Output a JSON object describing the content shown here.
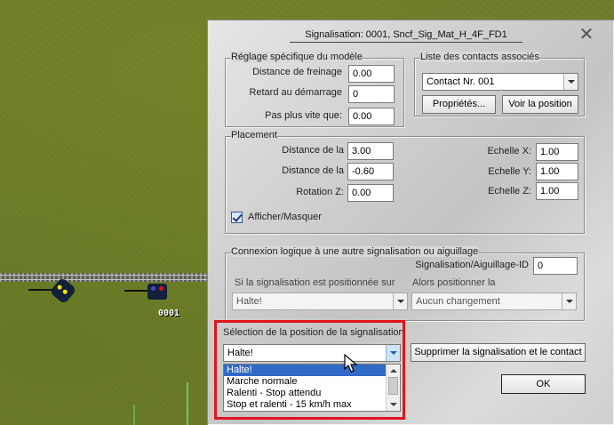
{
  "scene": {
    "signal_id_label": "0001"
  },
  "dialog": {
    "title": "Signalisation: 0001, Sncf_Sig_Mat_H_4F_FD1",
    "close_icon": "close-icon",
    "model_group": {
      "legend": "Réglage spécifique du modèle",
      "fields": [
        {
          "label": "Distance de freinage",
          "value": "0.00"
        },
        {
          "label": "Retard au démarrage",
          "value": "0"
        },
        {
          "label": "Pas plus vite que:",
          "value": "0.00"
        }
      ]
    },
    "contacts_group": {
      "legend": "Liste des contacts associés",
      "selected": "Contact Nr. 001",
      "properties_button": "Propriétés...",
      "view_position_button": "Voir la position"
    },
    "placement_group": {
      "legend": "Placement",
      "fields": [
        {
          "label": "Distance de la",
          "value": "3.00"
        },
        {
          "label": "Distance de la",
          "value": "-0.60"
        },
        {
          "label": "Rotation Z:",
          "value": "0.00"
        }
      ],
      "scales": [
        {
          "label": "Echelle X:",
          "value": "1.00"
        },
        {
          "label": "Echelle Y:",
          "value": "1.00"
        },
        {
          "label": "Echelle Z:",
          "value": "1.00"
        }
      ],
      "show_hide_label": "Afficher/Masquer",
      "show_hide_checked": true
    },
    "logic_group": {
      "legend": "Connexion logique à une autre signalisation ou aiguillage",
      "id_label": "Signalisation/Aiguillage-ID",
      "id_value": "0",
      "if_label": "Si la signalisation est positionnée sur",
      "if_value": "Halte!",
      "then_label": "Alors positionner la",
      "then_value": "Aucun changement"
    },
    "position_section": {
      "label": "Sélection de la position de la signalisation",
      "selected": "Halte!",
      "options": [
        "Halte!",
        "Marche normale",
        "Ralenti - Stop attendu",
        "Stop et ralenti - 15 km/h max"
      ],
      "selected_index": 0
    },
    "delete_button": "Supprimer la signalisation et le contact",
    "ok_button": "OK"
  },
  "colors": {
    "highlight": "#e0141c",
    "selection": "#3169c6"
  }
}
